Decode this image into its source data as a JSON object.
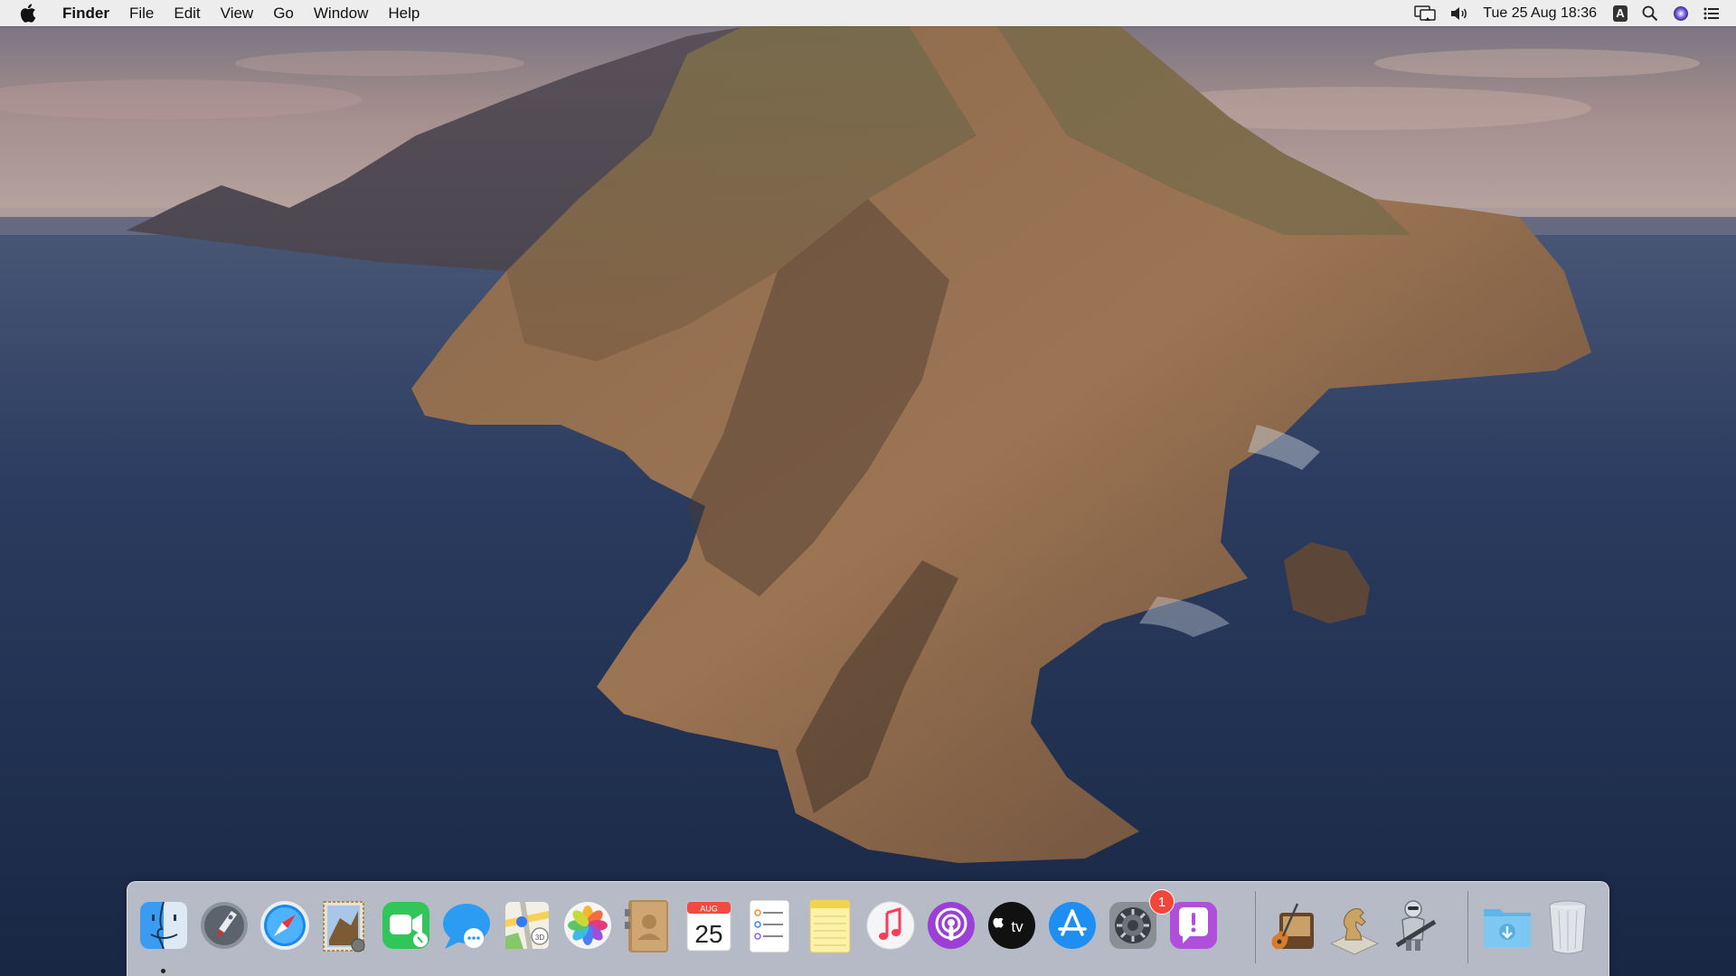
{
  "menubar": {
    "app_name": "Finder",
    "menus": [
      "File",
      "Edit",
      "View",
      "Go",
      "Window",
      "Help"
    ],
    "clock": "Tue 25 Aug  18:36",
    "input_source": "A",
    "status_icons": [
      "display-mirroring-icon",
      "volume-icon",
      "input-source-icon",
      "spotlight-search-icon",
      "siri-icon",
      "notification-center-icon"
    ]
  },
  "desktop": {
    "wallpaper": "catalina-island",
    "colors": {
      "sky_top": "#7d7a86",
      "sea": "#1e3054",
      "rock": "#7a5a3e"
    }
  },
  "dock": {
    "apps": [
      {
        "name": "finder-icon",
        "running": true
      },
      {
        "name": "launchpad-icon"
      },
      {
        "name": "safari-icon"
      },
      {
        "name": "mail-icon"
      },
      {
        "name": "facetime-icon"
      },
      {
        "name": "messages-icon"
      },
      {
        "name": "maps-icon"
      },
      {
        "name": "photos-icon"
      },
      {
        "name": "contacts-icon"
      },
      {
        "name": "calendar-icon",
        "month": "AUG",
        "day": "25"
      },
      {
        "name": "reminders-icon"
      },
      {
        "name": "notes-icon"
      },
      {
        "name": "music-icon"
      },
      {
        "name": "podcasts-icon"
      },
      {
        "name": "apple-tv-icon",
        "label": "tv"
      },
      {
        "name": "app-store-icon"
      },
      {
        "name": "system-preferences-icon",
        "badge": "1"
      },
      {
        "name": "feedback-assistant-icon"
      },
      {
        "name": "garageband-icon"
      },
      {
        "name": "chess-icon"
      },
      {
        "name": "automator-icon"
      },
      {
        "name": "downloads-folder-icon"
      },
      {
        "name": "trash-icon"
      }
    ]
  }
}
